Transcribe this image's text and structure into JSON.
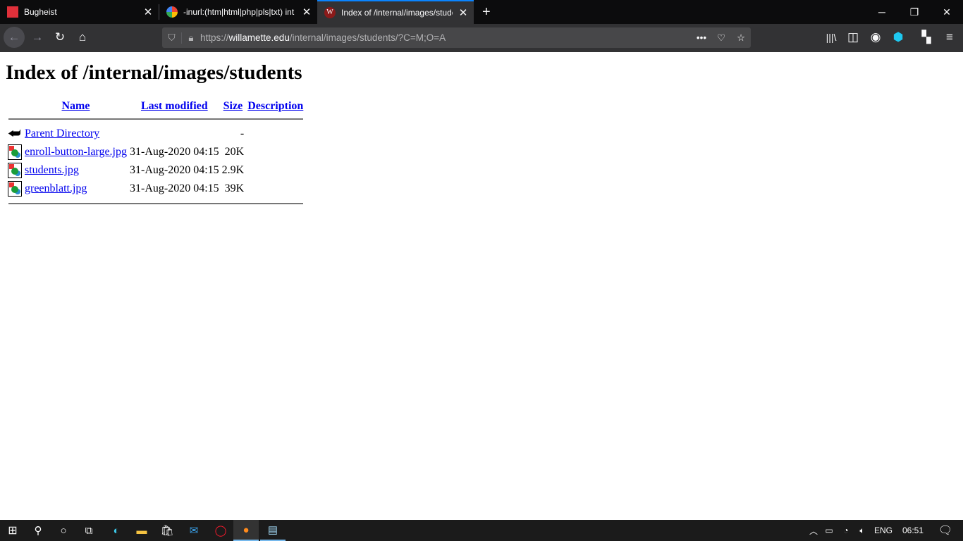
{
  "browser": {
    "tabs": [
      {
        "title": "Bugheist",
        "icon": "bugheist-logo-icon",
        "active": false
      },
      {
        "title": "-inurl:(htm|html|php|pls|txt) int",
        "icon": "google-logo-icon",
        "active": false
      },
      {
        "title": "Index of /internal/images/stude",
        "icon": "willamette-logo-icon",
        "active": true
      }
    ],
    "new_tab": "+",
    "url": {
      "scheme": "https://",
      "host": "willamette.edu",
      "path": "/internal/images/students/?C=M;O=A"
    },
    "accent": "#0a84ff"
  },
  "page": {
    "title": "Index of /internal/images/students",
    "columns": [
      "Name",
      "Last modified",
      "Size",
      "Description"
    ],
    "rows": [
      {
        "icon": "back-arrow-icon",
        "name": "Parent Directory",
        "modified": "",
        "size": "-",
        "description": ""
      },
      {
        "icon": "image-file-icon",
        "name": "enroll-button-large.jpg",
        "modified": "31-Aug-2020 04:15",
        "size": "20K",
        "description": ""
      },
      {
        "icon": "image-file-icon",
        "name": "students.jpg",
        "modified": "31-Aug-2020 04:15",
        "size": "2.9K",
        "description": ""
      },
      {
        "icon": "image-file-icon",
        "name": "greenblatt.jpg",
        "modified": "31-Aug-2020 04:15",
        "size": "39K",
        "description": ""
      }
    ]
  },
  "taskbar": {
    "language": "ENG",
    "time": "06:51"
  }
}
